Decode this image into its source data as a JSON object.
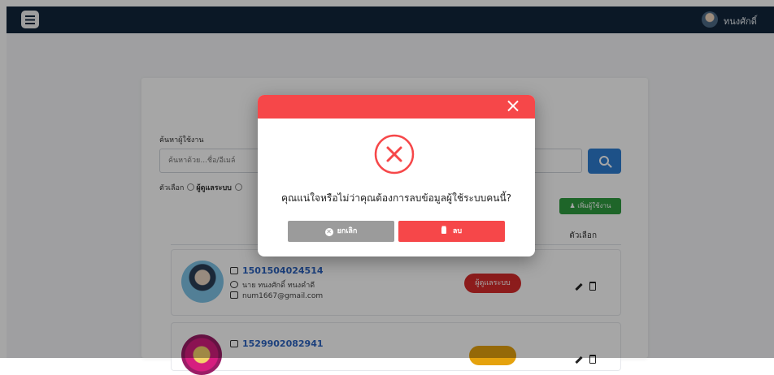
{
  "topbar": {
    "user_name": "ทนงศักดิ์"
  },
  "search": {
    "label": "ค้นหาผู้ใช้งาน",
    "placeholder": "ค้นหาด้วย...ชื่อ/อีเมล์"
  },
  "filter": {
    "label": "ตัวเลือก",
    "option1": "ผู้ดูแลระบบ"
  },
  "add_button": "เพิ่มผู้ใช้งาน",
  "table": {
    "actions_header": "ตัวเลือก"
  },
  "users": [
    {
      "id": "1501504024514",
      "name": "นาย ทนงศักดิ์ ทนงคำดี",
      "email": "num1667@gmail.com",
      "role": "ผู้ดูแลระบบ"
    },
    {
      "id": "1529902082941"
    }
  ],
  "modal": {
    "message": "คุณแน่ใจหรือไม่ว่าคุณต้องการลบข้อมูลผู้ใช้ระบบคนนี้?",
    "cancel_label": "ยกเลิก",
    "delete_label": "ลบ"
  },
  "colors": {
    "topbar": "#11253b",
    "accent_red": "#f64749",
    "cancel_gray": "#9b9b9b"
  },
  "icons": [
    "menu-icon",
    "search-icon",
    "add-user-icon",
    "id-card-icon",
    "user-icon",
    "mail-icon",
    "edit-icon",
    "delete-icon",
    "close-icon",
    "error-circle-icon",
    "cancel-circle-icon",
    "trash-icon"
  ]
}
